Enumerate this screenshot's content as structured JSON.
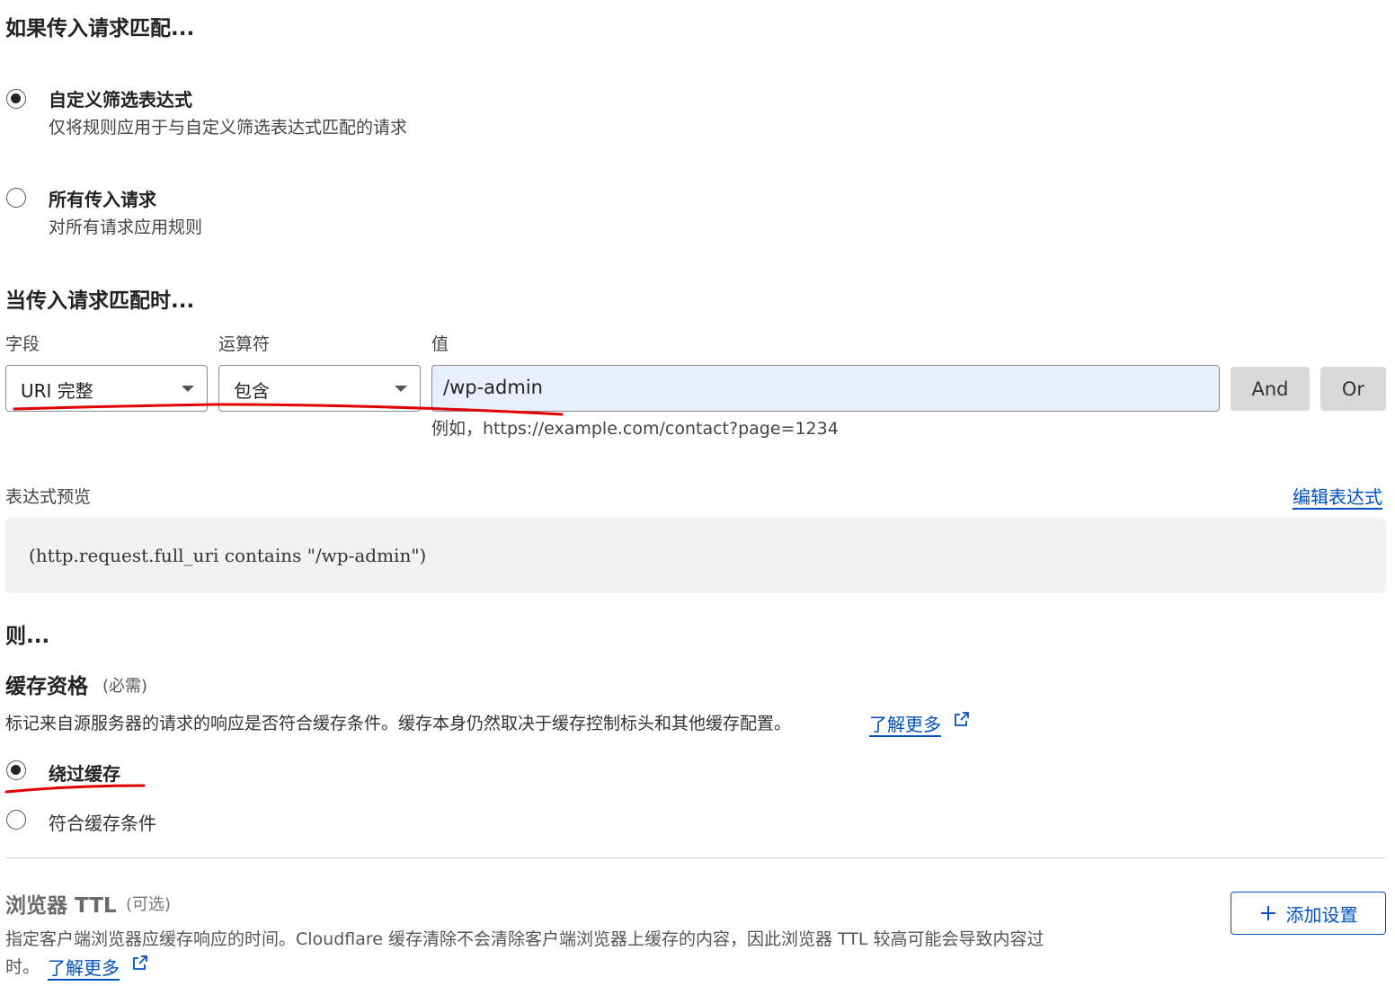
{
  "sec1": {
    "title": "如果传入请求匹配..."
  },
  "opt_custom": {
    "label": "自定义筛选表达式",
    "desc": "仅将规则应用于与自定义筛选表达式匹配的请求"
  },
  "opt_all": {
    "label": "所有传入请求",
    "desc": "对所有请求应用规则"
  },
  "sec2": {
    "title": "当传入请求匹配时..."
  },
  "filter": {
    "field_label": "字段",
    "operator_label": "运算符",
    "value_label": "值",
    "field_value": "URI 完整",
    "operator_value": "包含",
    "value_input": "/wp-admin",
    "hint": "例如，https://example.com/contact?page=1234",
    "and_label": "And",
    "or_label": "Or"
  },
  "preview": {
    "label": "表达式预览",
    "edit_link": "编辑表达式",
    "expression": "(http.request.full_uri contains \"/wp-admin\")"
  },
  "then": {
    "title": "则..."
  },
  "cache": {
    "title": "缓存资格",
    "required": "(必需)",
    "desc": "标记来自源服务器的请求的响应是否符合缓存条件。缓存本身仍然取决于缓存控制标头和其他缓存配置。",
    "learn_more": "了解更多",
    "option_bypass": "绕过缓存",
    "option_eligible": "符合缓存条件"
  },
  "browser_ttl": {
    "title": "浏览器 TTL",
    "optional": "(可选)",
    "desc_line1": "指定客户端浏览器应缓存响应的时间。Cloudflare 缓存清除不会清除客户端浏览器上缓存的内容，因此浏览器 TTL 较高可能会导致内容过",
    "desc_line2": "时。",
    "learn_more": "了解更多",
    "add_button": "添加设置"
  },
  "colors": {
    "link": "#0051c3",
    "annotation": "#e00000",
    "input_fill": "#e8f0fe",
    "preview_bg": "#f2f2f2",
    "button_gray": "#d9d9d9"
  },
  "icons": [
    "external-link-icon",
    "plus-icon",
    "caret-down-icon"
  ]
}
